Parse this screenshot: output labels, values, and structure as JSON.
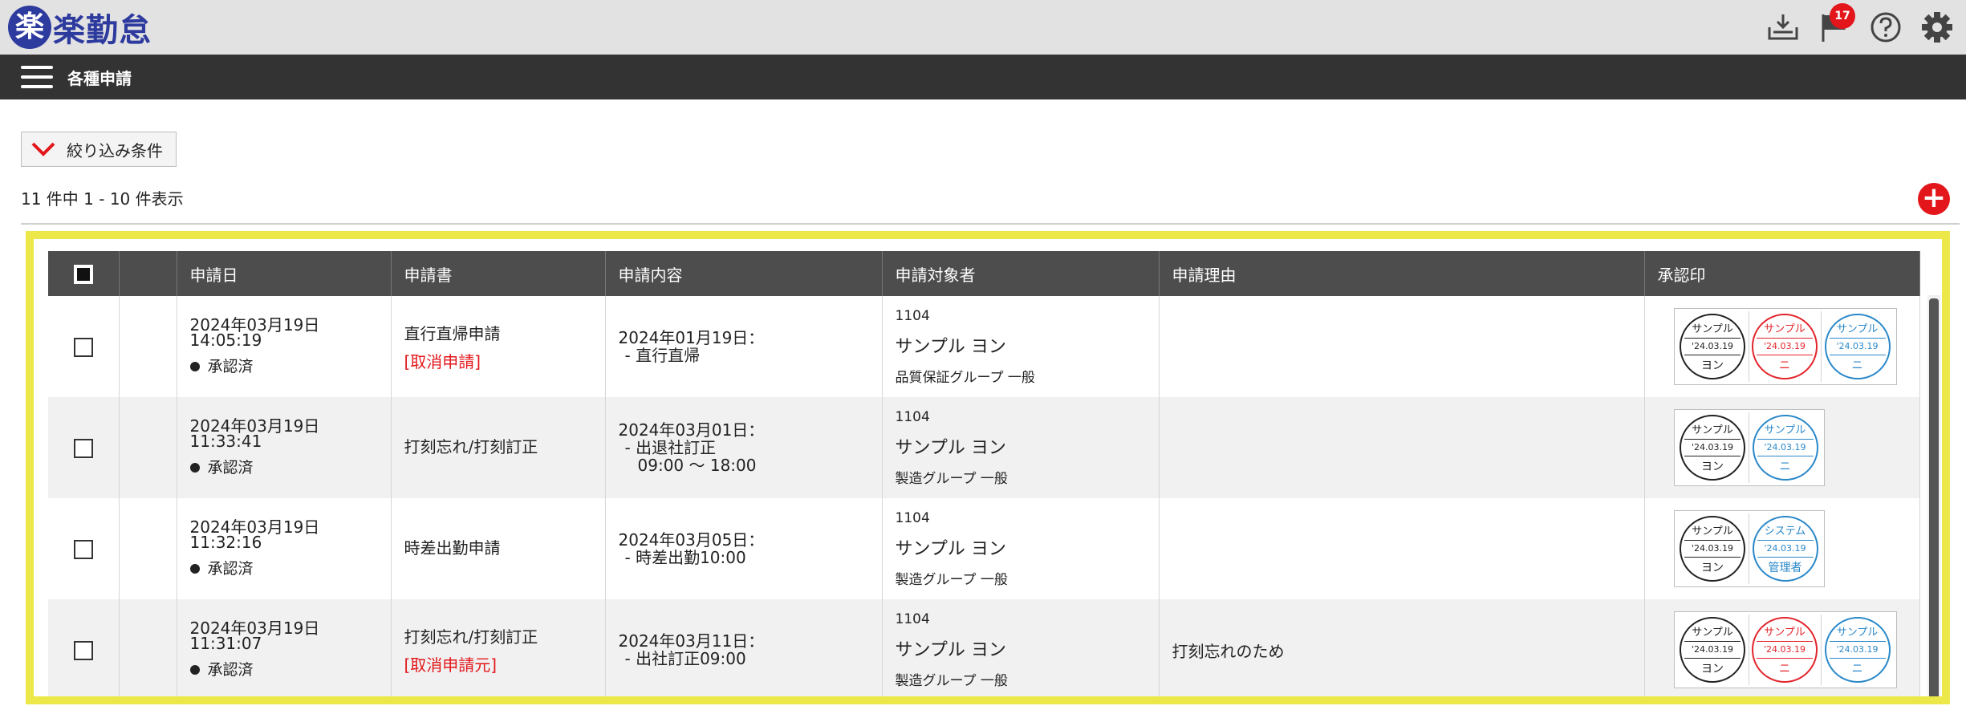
{
  "app": {
    "logo_mark": "楽",
    "logo_text": "楽勤怠"
  },
  "header_icons": {
    "notification_count": "17"
  },
  "nav": {
    "title": "各種申請"
  },
  "filter": {
    "label": "絞り込み条件"
  },
  "list": {
    "count_text": "11 件中 1 - 10 件表示"
  },
  "table": {
    "headers": [
      "申請日",
      "申請書",
      "申請内容",
      "申請対象者",
      "申請理由",
      "承認印"
    ],
    "rows": [
      {
        "date": "2024年03月19日",
        "time": "14:05:19",
        "status": "承認済",
        "form": "直行直帰申請",
        "tag": "[取消申請]",
        "content": [
          "2024年01月19日：",
          "- 直行直帰",
          ""
        ],
        "emp_id": "1104",
        "emp_name": "サンプル ヨン",
        "emp_group": "品質保証グループ 一般",
        "reason": "",
        "stamps": [
          {
            "top": "サンプル",
            "date": "'24.03.19",
            "bottom": "ヨン",
            "color": "#222222"
          },
          {
            "top": "サンプル",
            "date": "'24.03.19",
            "bottom": "ニ",
            "color": "#e3242b"
          },
          {
            "top": "サンプル",
            "date": "'24.03.19",
            "bottom": "ニ",
            "color": "#2a88c9"
          }
        ]
      },
      {
        "date": "2024年03月19日",
        "time": "11:33:41",
        "status": "承認済",
        "form": "打刻忘れ/打刻訂正",
        "tag": "",
        "content": [
          "2024年03月01日：",
          "- 出退社訂正",
          "09:00 ～ 18:00"
        ],
        "emp_id": "1104",
        "emp_name": "サンプル ヨン",
        "emp_group": "製造グループ 一般",
        "reason": "",
        "stamps": [
          {
            "top": "サンプル",
            "date": "'24.03.19",
            "bottom": "ヨン",
            "color": "#222222"
          },
          {
            "top": "サンプル",
            "date": "'24.03.19",
            "bottom": "ニ",
            "color": "#2a88c9"
          }
        ]
      },
      {
        "date": "2024年03月19日",
        "time": "11:32:16",
        "status": "承認済",
        "form": "時差出勤申請",
        "tag": "",
        "content": [
          "2024年03月05日：",
          "- 時差出勤10:00",
          ""
        ],
        "emp_id": "1104",
        "emp_name": "サンプル ヨン",
        "emp_group": "製造グループ 一般",
        "reason": "",
        "stamps": [
          {
            "top": "サンプル",
            "date": "'24.03.19",
            "bottom": "ヨン",
            "color": "#222222"
          },
          {
            "top": "システム",
            "date": "'24.03.19",
            "bottom": "管理者",
            "color": "#2a88c9"
          }
        ]
      },
      {
        "date": "2024年03月19日",
        "time": "11:31:07",
        "status": "承認済",
        "form": "打刻忘れ/打刻訂正",
        "tag": "[取消申請元]",
        "content": [
          "2024年03月11日：",
          "- 出社訂正09:00",
          ""
        ],
        "emp_id": "1104",
        "emp_name": "サンプル ヨン",
        "emp_group": "製造グループ 一般",
        "reason": "打刻忘れのため",
        "stamps": [
          {
            "top": "サンプル",
            "date": "'24.03.19",
            "bottom": "ヨン",
            "color": "#222222"
          },
          {
            "top": "サンプル",
            "date": "'24.03.19",
            "bottom": "ニ",
            "color": "#e3242b"
          },
          {
            "top": "サンプル",
            "date": "'24.03.19",
            "bottom": "ニ",
            "color": "#2a88c9"
          }
        ]
      }
    ]
  },
  "colors": {
    "brand": "#2d3a9e",
    "accent_red": "#e3171b",
    "highlight": "#ece84a",
    "header_bg": "#4d4d4d"
  },
  "icons": [
    "inbox-download-icon",
    "flag-icon",
    "help-icon",
    "gear-icon",
    "hamburger-icon",
    "chevron-down-icon",
    "plus-icon"
  ]
}
